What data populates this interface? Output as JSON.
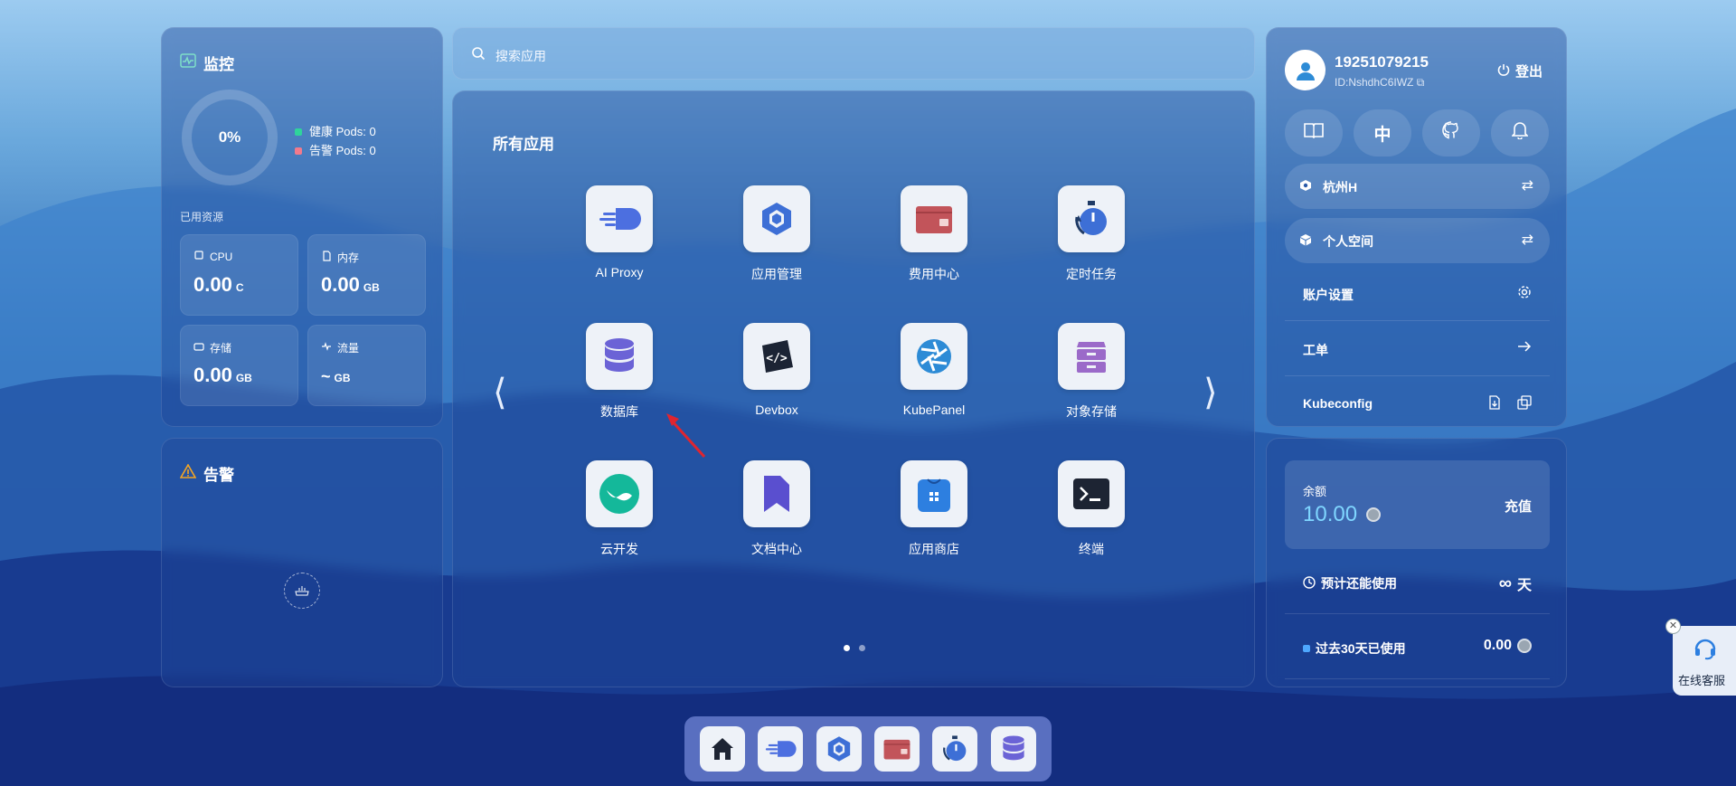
{
  "monitor": {
    "title": "监控",
    "usage_percent": "0%",
    "healthy_pods": "健康 Pods: 0",
    "alert_pods": "告警 Pods: 0",
    "used_resources_label": "已用资源",
    "resources": [
      {
        "label": "CPU",
        "value": "0.00",
        "unit": "C"
      },
      {
        "label": "内存",
        "value": "0.00",
        "unit": "GB"
      },
      {
        "label": "存储",
        "value": "0.00",
        "unit": "GB"
      },
      {
        "label": "流量",
        "value": "~",
        "unit": "GB"
      }
    ],
    "colors": {
      "healthy": "#2fd49b",
      "alert": "#f27a8c"
    }
  },
  "alerts": {
    "title": "告警"
  },
  "search": {
    "placeholder": "搜索应用"
  },
  "apps": {
    "title": "所有应用",
    "items": [
      {
        "name": "AI Proxy",
        "icon": "ai-proxy-icon"
      },
      {
        "name": "应用管理",
        "icon": "app-manage-icon"
      },
      {
        "name": "费用中心",
        "icon": "wallet-icon"
      },
      {
        "name": "定时任务",
        "icon": "timer-icon"
      },
      {
        "name": "数据库",
        "icon": "database-icon"
      },
      {
        "name": "Devbox",
        "icon": "devbox-icon"
      },
      {
        "name": "KubePanel",
        "icon": "kubepanel-icon"
      },
      {
        "name": "对象存储",
        "icon": "object-storage-icon"
      },
      {
        "name": "云开发",
        "icon": "cloud-dev-icon"
      },
      {
        "name": "文档中心",
        "icon": "docs-icon"
      },
      {
        "name": "应用商店",
        "icon": "app-store-icon"
      },
      {
        "name": "终端",
        "icon": "terminal-icon"
      }
    ],
    "pager": {
      "current": 1,
      "total": 2
    }
  },
  "user": {
    "name": "19251079215",
    "id": "ID:NshdhC6IWZ",
    "logout": "登出",
    "quick_buttons": [
      "book-icon",
      "中",
      "github-icon",
      "bell-icon"
    ],
    "region": "杭州H",
    "workspace": "个人空间",
    "menu": [
      {
        "label": "账户设置"
      },
      {
        "label": "工单"
      },
      {
        "label": "Kubeconfig"
      }
    ]
  },
  "balance": {
    "label": "余额",
    "amount": "10.00",
    "recharge": "充值",
    "remaining_label": "预计还能使用",
    "remaining_value": "天",
    "past30_label": "过去30天已使用",
    "past30_value": "0.00"
  },
  "service": {
    "label": "在线客服"
  }
}
